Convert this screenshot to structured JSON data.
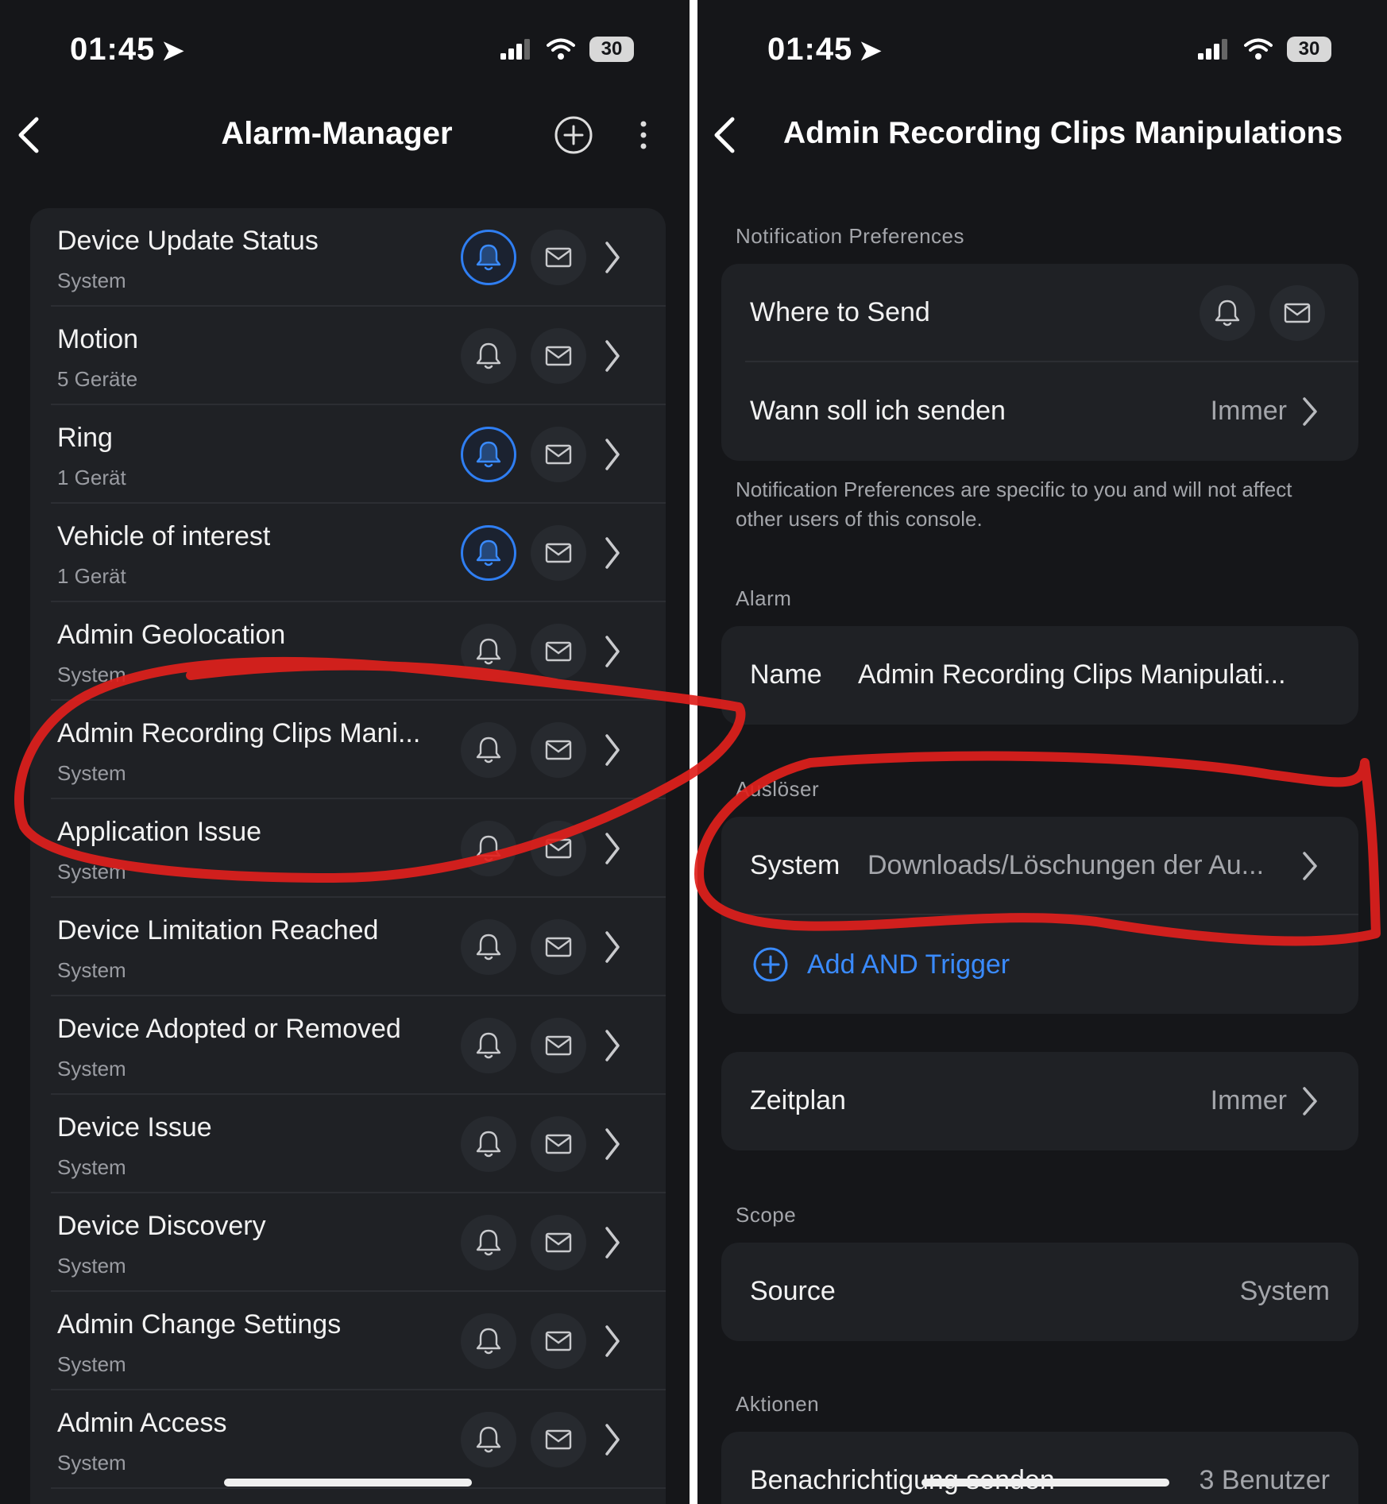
{
  "status_bar": {
    "time": "01:45",
    "battery": "30"
  },
  "left_screen": {
    "title": "Alarm-Manager",
    "alarms": [
      {
        "title": "Device Update Status",
        "subtitle": "System",
        "bell_active": true
      },
      {
        "title": "Motion",
        "subtitle": "5 Geräte",
        "bell_active": false
      },
      {
        "title": "Ring",
        "subtitle": "1 Gerät",
        "bell_active": true
      },
      {
        "title": "Vehicle of interest",
        "subtitle": "1 Gerät",
        "bell_active": true
      },
      {
        "title": "Admin Geolocation",
        "subtitle": "System",
        "bell_active": false
      },
      {
        "title": "Admin Recording Clips Mani...",
        "subtitle": "System",
        "bell_active": false
      },
      {
        "title": "Application Issue",
        "subtitle": "System",
        "bell_active": false
      },
      {
        "title": "Device Limitation Reached",
        "subtitle": "System",
        "bell_active": false
      },
      {
        "title": "Device Adopted or Removed",
        "subtitle": "System",
        "bell_active": false
      },
      {
        "title": "Device Issue",
        "subtitle": "System",
        "bell_active": false
      },
      {
        "title": "Device Discovery",
        "subtitle": "System",
        "bell_active": false
      },
      {
        "title": "Admin Change Settings",
        "subtitle": "System",
        "bell_active": false
      },
      {
        "title": "Admin Access",
        "subtitle": "System",
        "bell_active": false
      }
    ]
  },
  "right_screen": {
    "title": "Admin Recording Clips Manipulations",
    "notification_preferences": {
      "section_label": "Notification Preferences",
      "where_to_send": "Where to Send",
      "when_label": "Wann soll ich senden",
      "when_value": "Immer",
      "note": "Notification Preferences are specific to you and will not affect other users of this console."
    },
    "alarm": {
      "section_label": "Alarm",
      "name_label": "Name",
      "name_value": "Admin Recording Clips Manipulati..."
    },
    "trigger": {
      "section_label": "Auslöser",
      "label": "System",
      "value": "Downloads/Löschungen der Au...",
      "add_label": "Add AND Trigger"
    },
    "schedule": {
      "label": "Zeitplan",
      "value": "Immer"
    },
    "scope": {
      "section_label": "Scope",
      "source_label": "Source",
      "source_value": "System"
    },
    "actions": {
      "section_label": "Aktionen",
      "label": "Benachrichtigung senden",
      "value": "3 Benutzer"
    }
  },
  "colors": {
    "background": "#151619",
    "card": "#1f2125",
    "accent": "#2f7ef2",
    "annotation": "#e0201c"
  },
  "icons": [
    "back-chevron-icon",
    "add-circle-icon",
    "more-vertical-icon",
    "bell-icon",
    "mail-icon",
    "chevron-right-icon",
    "location-arrow-icon",
    "signal-icon",
    "wifi-icon",
    "battery-icon"
  ]
}
